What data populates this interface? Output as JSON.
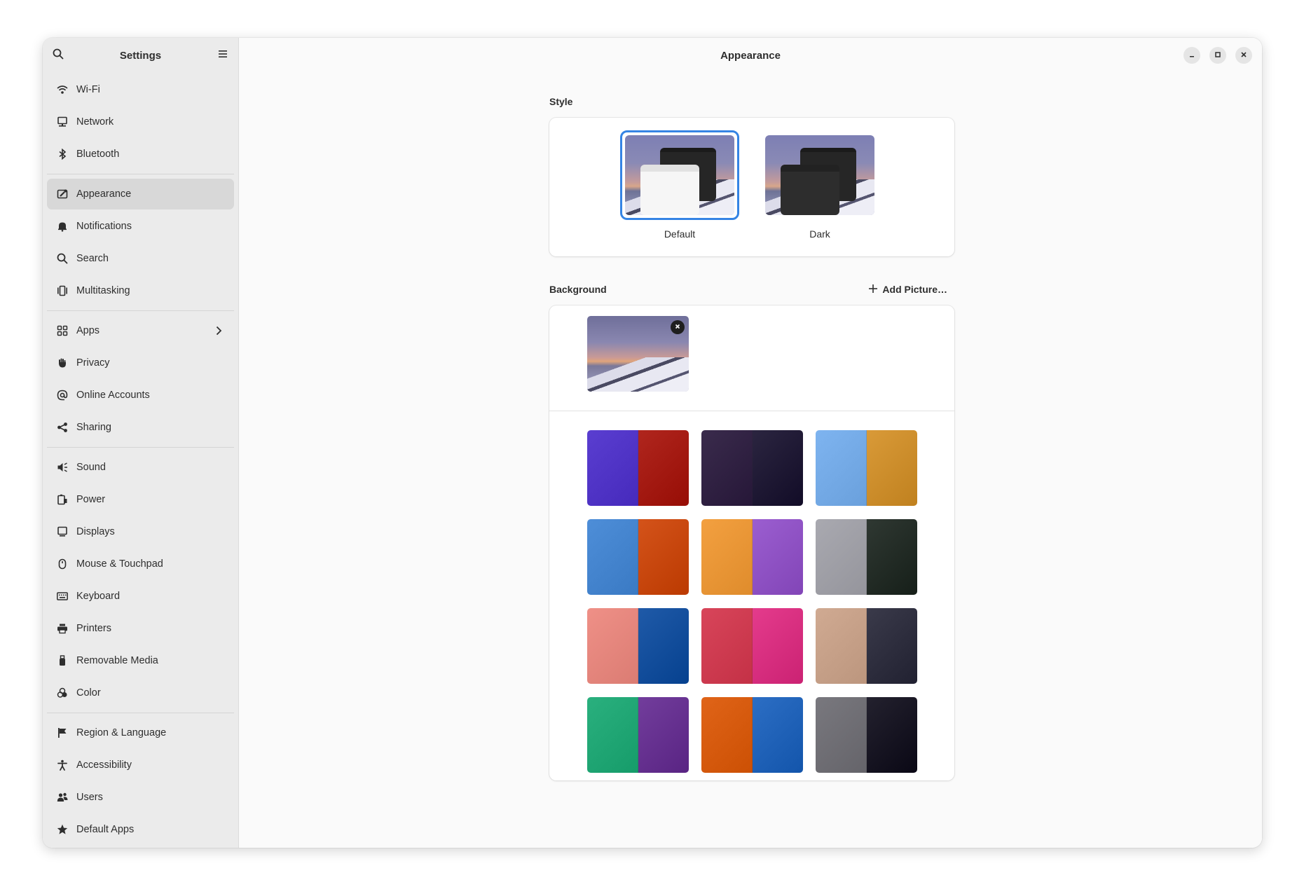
{
  "sidebar": {
    "title": "Settings",
    "search_icon": "search-icon",
    "menu_icon": "hamburger-menu-icon",
    "groups": [
      [
        {
          "id": "wifi",
          "label": "Wi-Fi",
          "icon": "wifi-icon"
        },
        {
          "id": "network",
          "label": "Network",
          "icon": "network-icon"
        },
        {
          "id": "bluetooth",
          "label": "Bluetooth",
          "icon": "bluetooth-icon"
        }
      ],
      [
        {
          "id": "appearance",
          "label": "Appearance",
          "icon": "appearance-icon",
          "active": true
        },
        {
          "id": "notifications",
          "label": "Notifications",
          "icon": "bell-icon"
        },
        {
          "id": "search",
          "label": "Search",
          "icon": "search-icon"
        },
        {
          "id": "multitasking",
          "label": "Multitasking",
          "icon": "multitasking-icon"
        }
      ],
      [
        {
          "id": "apps",
          "label": "Apps",
          "icon": "apps-icon",
          "chevron": true
        },
        {
          "id": "privacy",
          "label": "Privacy",
          "icon": "hand-icon"
        },
        {
          "id": "online-accounts",
          "label": "Online Accounts",
          "icon": "at-icon"
        },
        {
          "id": "sharing",
          "label": "Sharing",
          "icon": "share-icon"
        }
      ],
      [
        {
          "id": "sound",
          "label": "Sound",
          "icon": "speaker-icon"
        },
        {
          "id": "power",
          "label": "Power",
          "icon": "power-icon"
        },
        {
          "id": "displays",
          "label": "Displays",
          "icon": "display-icon"
        },
        {
          "id": "mouse-touchpad",
          "label": "Mouse & Touchpad",
          "icon": "mouse-icon"
        },
        {
          "id": "keyboard",
          "label": "Keyboard",
          "icon": "keyboard-icon"
        },
        {
          "id": "printers",
          "label": "Printers",
          "icon": "printer-icon"
        },
        {
          "id": "removable-media",
          "label": "Removable Media",
          "icon": "usb-icon"
        },
        {
          "id": "color",
          "label": "Color",
          "icon": "color-icon"
        }
      ],
      [
        {
          "id": "region-language",
          "label": "Region & Language",
          "icon": "flag-icon"
        },
        {
          "id": "accessibility",
          "label": "Accessibility",
          "icon": "accessibility-icon"
        },
        {
          "id": "users",
          "label": "Users",
          "icon": "users-icon"
        },
        {
          "id": "default-apps",
          "label": "Default Apps",
          "icon": "star-icon"
        }
      ]
    ]
  },
  "main": {
    "title": "Appearance",
    "window_controls": [
      "minimize-icon",
      "maximize-icon",
      "close-icon"
    ],
    "style": {
      "section_title": "Style",
      "options": [
        {
          "label": "Default",
          "selected": true,
          "variant": "light"
        },
        {
          "label": "Dark",
          "selected": false,
          "variant": "dark"
        }
      ]
    },
    "background": {
      "section_title": "Background",
      "add_label": "Add Picture…",
      "wallpapers": [
        {
          "left": "#5a3ed0",
          "right": "#b0261e"
        },
        {
          "left": "#3a2b4c",
          "right": "#2b2540"
        },
        {
          "left": "#7eb4f0",
          "right": "#d99a38"
        },
        {
          "left": "#4e8ed8",
          "right": "#d4531a"
        },
        {
          "left": "#f3a040",
          "right": "#9b5ed0"
        },
        {
          "left": "#a9a9b0",
          "right": "#2f3832"
        },
        {
          "left": "#ef9087",
          "right": "#1f5aa8"
        },
        {
          "left": "#d8455a",
          "right": "#e43b8c"
        },
        {
          "left": "#d0aa92",
          "right": "#3a3a4a"
        },
        {
          "left": "#2ab07e",
          "right": "#723d9c"
        },
        {
          "left": "#e06418",
          "right": "#2c6ec4"
        },
        {
          "left": "#79787e",
          "right": "#23212e"
        }
      ]
    }
  }
}
